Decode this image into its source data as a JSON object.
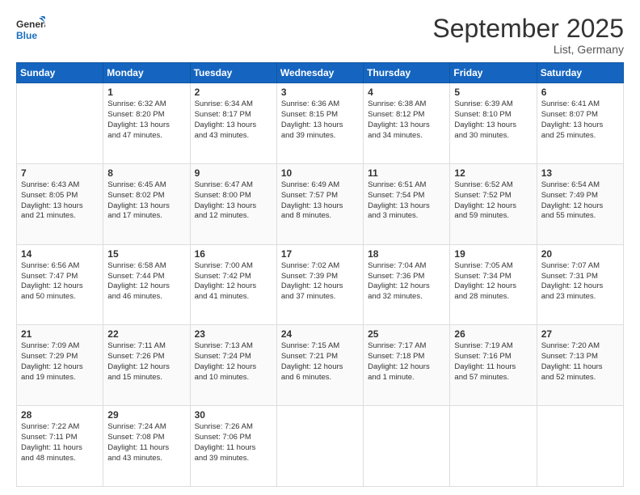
{
  "header": {
    "logo_general": "General",
    "logo_blue": "Blue",
    "month": "September 2025",
    "location": "List, Germany"
  },
  "days_of_week": [
    "Sunday",
    "Monday",
    "Tuesday",
    "Wednesday",
    "Thursday",
    "Friday",
    "Saturday"
  ],
  "weeks": [
    [
      {
        "day": "",
        "info": ""
      },
      {
        "day": "1",
        "info": "Sunrise: 6:32 AM\nSunset: 8:20 PM\nDaylight: 13 hours\nand 47 minutes."
      },
      {
        "day": "2",
        "info": "Sunrise: 6:34 AM\nSunset: 8:17 PM\nDaylight: 13 hours\nand 43 minutes."
      },
      {
        "day": "3",
        "info": "Sunrise: 6:36 AM\nSunset: 8:15 PM\nDaylight: 13 hours\nand 39 minutes."
      },
      {
        "day": "4",
        "info": "Sunrise: 6:38 AM\nSunset: 8:12 PM\nDaylight: 13 hours\nand 34 minutes."
      },
      {
        "day": "5",
        "info": "Sunrise: 6:39 AM\nSunset: 8:10 PM\nDaylight: 13 hours\nand 30 minutes."
      },
      {
        "day": "6",
        "info": "Sunrise: 6:41 AM\nSunset: 8:07 PM\nDaylight: 13 hours\nand 25 minutes."
      }
    ],
    [
      {
        "day": "7",
        "info": "Sunrise: 6:43 AM\nSunset: 8:05 PM\nDaylight: 13 hours\nand 21 minutes."
      },
      {
        "day": "8",
        "info": "Sunrise: 6:45 AM\nSunset: 8:02 PM\nDaylight: 13 hours\nand 17 minutes."
      },
      {
        "day": "9",
        "info": "Sunrise: 6:47 AM\nSunset: 8:00 PM\nDaylight: 13 hours\nand 12 minutes."
      },
      {
        "day": "10",
        "info": "Sunrise: 6:49 AM\nSunset: 7:57 PM\nDaylight: 13 hours\nand 8 minutes."
      },
      {
        "day": "11",
        "info": "Sunrise: 6:51 AM\nSunset: 7:54 PM\nDaylight: 13 hours\nand 3 minutes."
      },
      {
        "day": "12",
        "info": "Sunrise: 6:52 AM\nSunset: 7:52 PM\nDaylight: 12 hours\nand 59 minutes."
      },
      {
        "day": "13",
        "info": "Sunrise: 6:54 AM\nSunset: 7:49 PM\nDaylight: 12 hours\nand 55 minutes."
      }
    ],
    [
      {
        "day": "14",
        "info": "Sunrise: 6:56 AM\nSunset: 7:47 PM\nDaylight: 12 hours\nand 50 minutes."
      },
      {
        "day": "15",
        "info": "Sunrise: 6:58 AM\nSunset: 7:44 PM\nDaylight: 12 hours\nand 46 minutes."
      },
      {
        "day": "16",
        "info": "Sunrise: 7:00 AM\nSunset: 7:42 PM\nDaylight: 12 hours\nand 41 minutes."
      },
      {
        "day": "17",
        "info": "Sunrise: 7:02 AM\nSunset: 7:39 PM\nDaylight: 12 hours\nand 37 minutes."
      },
      {
        "day": "18",
        "info": "Sunrise: 7:04 AM\nSunset: 7:36 PM\nDaylight: 12 hours\nand 32 minutes."
      },
      {
        "day": "19",
        "info": "Sunrise: 7:05 AM\nSunset: 7:34 PM\nDaylight: 12 hours\nand 28 minutes."
      },
      {
        "day": "20",
        "info": "Sunrise: 7:07 AM\nSunset: 7:31 PM\nDaylight: 12 hours\nand 23 minutes."
      }
    ],
    [
      {
        "day": "21",
        "info": "Sunrise: 7:09 AM\nSunset: 7:29 PM\nDaylight: 12 hours\nand 19 minutes."
      },
      {
        "day": "22",
        "info": "Sunrise: 7:11 AM\nSunset: 7:26 PM\nDaylight: 12 hours\nand 15 minutes."
      },
      {
        "day": "23",
        "info": "Sunrise: 7:13 AM\nSunset: 7:24 PM\nDaylight: 12 hours\nand 10 minutes."
      },
      {
        "day": "24",
        "info": "Sunrise: 7:15 AM\nSunset: 7:21 PM\nDaylight: 12 hours\nand 6 minutes."
      },
      {
        "day": "25",
        "info": "Sunrise: 7:17 AM\nSunset: 7:18 PM\nDaylight: 12 hours\nand 1 minute."
      },
      {
        "day": "26",
        "info": "Sunrise: 7:19 AM\nSunset: 7:16 PM\nDaylight: 11 hours\nand 57 minutes."
      },
      {
        "day": "27",
        "info": "Sunrise: 7:20 AM\nSunset: 7:13 PM\nDaylight: 11 hours\nand 52 minutes."
      }
    ],
    [
      {
        "day": "28",
        "info": "Sunrise: 7:22 AM\nSunset: 7:11 PM\nDaylight: 11 hours\nand 48 minutes."
      },
      {
        "day": "29",
        "info": "Sunrise: 7:24 AM\nSunset: 7:08 PM\nDaylight: 11 hours\nand 43 minutes."
      },
      {
        "day": "30",
        "info": "Sunrise: 7:26 AM\nSunset: 7:06 PM\nDaylight: 11 hours\nand 39 minutes."
      },
      {
        "day": "",
        "info": ""
      },
      {
        "day": "",
        "info": ""
      },
      {
        "day": "",
        "info": ""
      },
      {
        "day": "",
        "info": ""
      }
    ]
  ]
}
